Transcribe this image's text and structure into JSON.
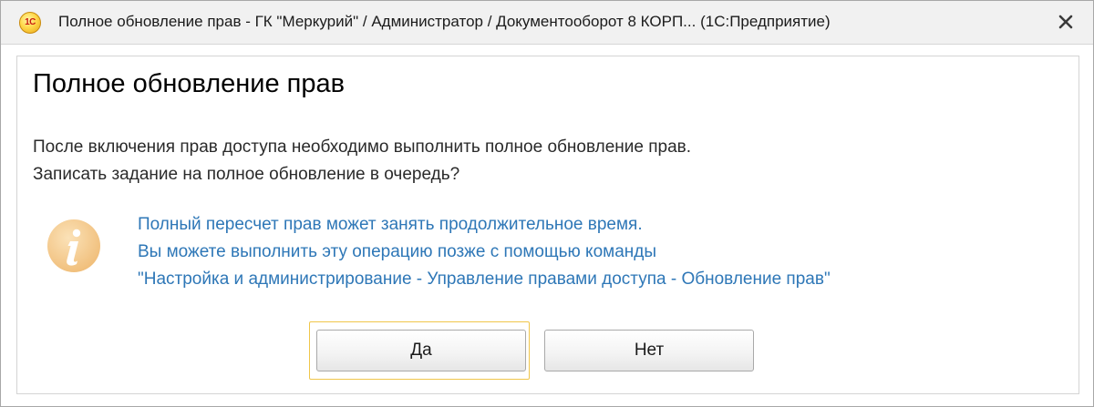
{
  "window": {
    "title": "Полное обновление прав - ГК \"Меркурий\" / Администратор / Документооборот 8 КОРП...  (1С:Предприятие)",
    "logo_text": "1С"
  },
  "dialog": {
    "heading": "Полное обновление прав",
    "message_lines": [
      "После включения прав доступа необходимо выполнить полное обновление прав.",
      "Записать задание на полное обновление в очередь?"
    ],
    "info_lines": [
      "Полный пересчет прав может занять продолжительное время.",
      "Вы можете выполнить эту операцию позже с помощью команды",
      "\"Настройка и администрирование - Управление правами доступа - Обновление прав\""
    ],
    "buttons": {
      "yes": "Да",
      "no": "Нет"
    }
  },
  "icons": {
    "logo": "1c-logo-icon",
    "close": "close-icon",
    "info": "info-icon"
  },
  "colors": {
    "info_text": "#2e77b7",
    "focus_border": "#f0c64a",
    "info_icon": "#f3c98c"
  }
}
